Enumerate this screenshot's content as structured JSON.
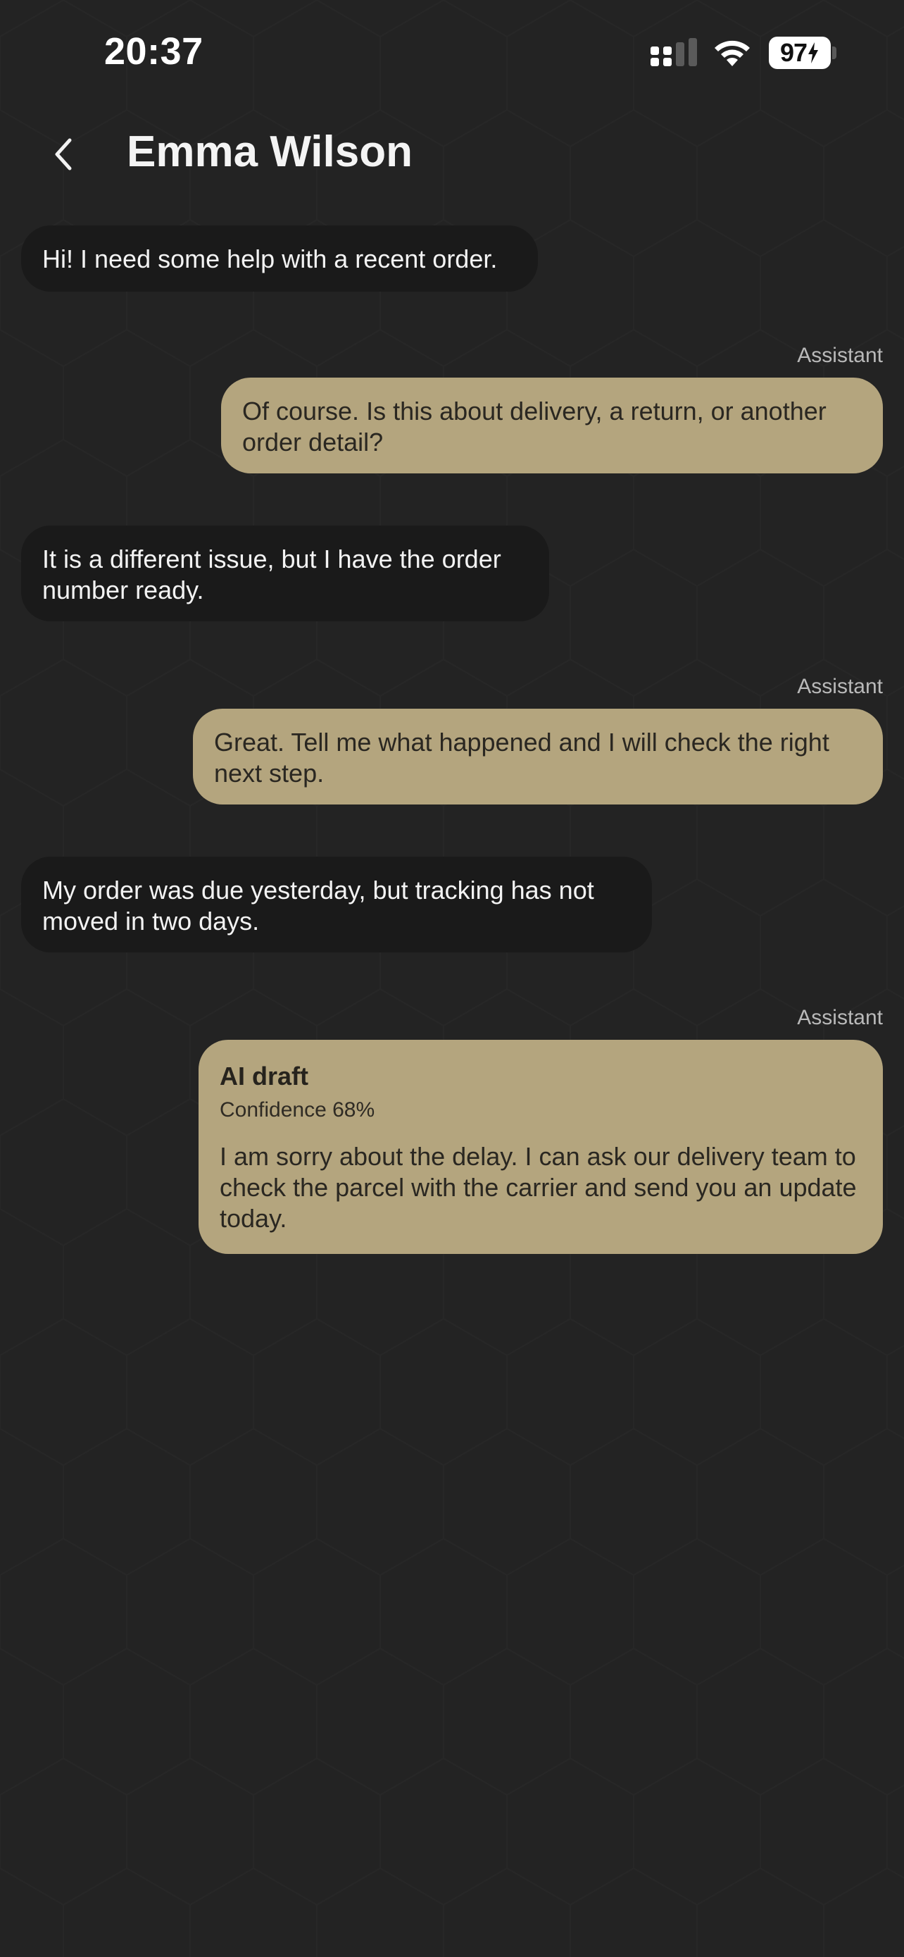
{
  "status_bar": {
    "time": "20:37",
    "battery": "97",
    "icons": [
      "signal-icon",
      "wifi-icon",
      "battery-charging-icon"
    ]
  },
  "header": {
    "back_icon": "chevron-left-icon",
    "contact_name": "Emma Wilson"
  },
  "messages": [
    {
      "role": "user",
      "text": "Hi! I need some help with a recent order."
    },
    {
      "role": "assistant",
      "sender": "Assistant",
      "text": "Of course. Is this about delivery, a return, or another order detail?"
    },
    {
      "role": "user",
      "text": "It is a different issue, but I have the order number ready."
    },
    {
      "role": "assistant",
      "sender": "Assistant",
      "text": "Great. Tell me what happened and I will check the right next step."
    },
    {
      "role": "user",
      "text": "My order was due yesterday, but tracking has not moved in two days."
    },
    {
      "role": "assistant",
      "sender": "Assistant",
      "draft_title": "AI draft",
      "confidence": "Confidence 68%",
      "text": "I am sorry about the delay. I can ask our delivery team to check the parcel with the carrier and send you an update today."
    }
  ],
  "colors": {
    "background": "#232323",
    "user_bubble": "#1a1a1a",
    "assistant_bubble": "#b4a57e",
    "label": "#b9b9b9"
  }
}
